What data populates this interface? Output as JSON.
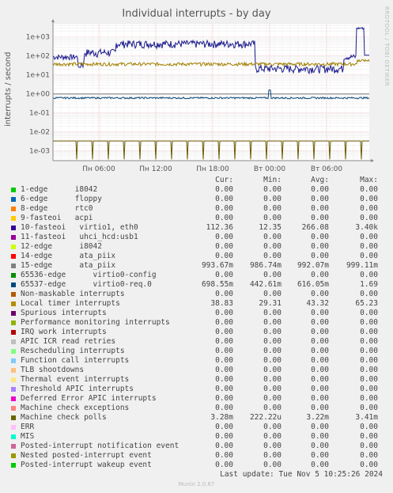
{
  "chart_data": {
    "type": "line",
    "title": "Individual interrupts - by day",
    "ylabel": "interrupts / second",
    "yscale": "log",
    "ylim": [
      0.0003,
      5000
    ],
    "yticks": [
      "1e+03",
      "1e+02",
      "1e+01",
      "1e+00",
      "1e-01",
      "1e-02",
      "1e-03"
    ],
    "xticks": [
      "Пн 06:00",
      "Пн 12:00",
      "Пн 18:00",
      "Вт 00:00",
      "Вт 06:00"
    ],
    "series": [
      {
        "name": "10-fasteoi   virtio1, eth0",
        "color": "#1a1a8c",
        "cur": "112.36",
        "min": "12.35",
        "avg": "266.08",
        "max": "3.40k"
      },
      {
        "name": "Local timer interrupts",
        "color": "#a08000",
        "cur": "38.83",
        "min": "29.31",
        "avg": "43.32",
        "max": "65.23"
      },
      {
        "name": "65537-edge      virtio0-req.0",
        "color": "#0a4a7a",
        "cur": "698.55m",
        "min": "442.61m",
        "avg": "616.05m",
        "max": "1.69"
      },
      {
        "name": "Machine check polls",
        "color": "#6a5a00",
        "cur": "3.28m",
        "min": "222.22u",
        "avg": "3.22m",
        "max": "3.41m"
      }
    ]
  },
  "labels": {
    "side": "RRDTOOL / TOBI OETIKER",
    "cur": "Cur:",
    "min": "Min:",
    "avg": "Avg:",
    "max": "Max:"
  },
  "legend": [
    {
      "name": "1-edge      i8042",
      "color": "#00cc00",
      "cur": "0.00",
      "min": "0.00",
      "avg": "0.00",
      "max": "0.00"
    },
    {
      "name": "6-edge      floppy",
      "color": "#0066b3",
      "cur": "0.00",
      "min": "0.00",
      "avg": "0.00",
      "max": "0.00"
    },
    {
      "name": "8-edge      rtc0",
      "color": "#ff8000",
      "cur": "0.00",
      "min": "0.00",
      "avg": "0.00",
      "max": "0.00"
    },
    {
      "name": "9-fasteoi   acpi",
      "color": "#ffcc00",
      "cur": "0.00",
      "min": "0.00",
      "avg": "0.00",
      "max": "0.00"
    },
    {
      "name": "10-fasteoi   virtio1, eth0",
      "color": "#330099",
      "cur": "112.36",
      "min": "12.35",
      "avg": "266.08",
      "max": "3.40k"
    },
    {
      "name": "11-fasteoi   uhci_hcd:usb1",
      "color": "#990099",
      "cur": "0.00",
      "min": "0.00",
      "avg": "0.00",
      "max": "0.00"
    },
    {
      "name": "12-edge      i8042",
      "color": "#ccff00",
      "cur": "0.00",
      "min": "0.00",
      "avg": "0.00",
      "max": "0.00"
    },
    {
      "name": "14-edge      ata_piix",
      "color": "#ff0000",
      "cur": "0.00",
      "min": "0.00",
      "avg": "0.00",
      "max": "0.00"
    },
    {
      "name": "15-edge      ata_piix",
      "color": "#808080",
      "cur": "993.67m",
      "min": "986.74m",
      "avg": "992.07m",
      "max": "999.11m"
    },
    {
      "name": "65536-edge      virtio0-config",
      "color": "#008f00",
      "cur": "0.00",
      "min": "0.00",
      "avg": "0.00",
      "max": "0.00"
    },
    {
      "name": "65537-edge      virtio0-req.0",
      "color": "#00487d",
      "cur": "698.55m",
      "min": "442.61m",
      "avg": "616.05m",
      "max": "1.69"
    },
    {
      "name": "Non-maskable interrupts",
      "color": "#b35a00",
      "cur": "0.00",
      "min": "0.00",
      "avg": "0.00",
      "max": "0.00"
    },
    {
      "name": "Local timer interrupts",
      "color": "#b38f00",
      "cur": "38.83",
      "min": "29.31",
      "avg": "43.32",
      "max": "65.23"
    },
    {
      "name": "Spurious interrupts",
      "color": "#6b006b",
      "cur": "0.00",
      "min": "0.00",
      "avg": "0.00",
      "max": "0.00"
    },
    {
      "name": "Performance monitoring interrupts",
      "color": "#8fb300",
      "cur": "0.00",
      "min": "0.00",
      "avg": "0.00",
      "max": "0.00"
    },
    {
      "name": "IRQ work interrupts",
      "color": "#b30000",
      "cur": "0.00",
      "min": "0.00",
      "avg": "0.00",
      "max": "0.00"
    },
    {
      "name": "APIC ICR read retries",
      "color": "#bebebe",
      "cur": "0.00",
      "min": "0.00",
      "avg": "0.00",
      "max": "0.00"
    },
    {
      "name": "Rescheduling interrupts",
      "color": "#80ff80",
      "cur": "0.00",
      "min": "0.00",
      "avg": "0.00",
      "max": "0.00"
    },
    {
      "name": "Function call interrupts",
      "color": "#80c9ff",
      "cur": "0.00",
      "min": "0.00",
      "avg": "0.00",
      "max": "0.00"
    },
    {
      "name": "TLB shootdowns",
      "color": "#ffc080",
      "cur": "0.00",
      "min": "0.00",
      "avg": "0.00",
      "max": "0.00"
    },
    {
      "name": "Thermal event interrupts",
      "color": "#ffe680",
      "cur": "0.00",
      "min": "0.00",
      "avg": "0.00",
      "max": "0.00"
    },
    {
      "name": "Threshold APIC interrupts",
      "color": "#aa80ff",
      "cur": "0.00",
      "min": "0.00",
      "avg": "0.00",
      "max": "0.00"
    },
    {
      "name": "Deferred Error APIC interrupts",
      "color": "#ee00cc",
      "cur": "0.00",
      "min": "0.00",
      "avg": "0.00",
      "max": "0.00"
    },
    {
      "name": "Machine check exceptions",
      "color": "#ff8080",
      "cur": "0.00",
      "min": "0.00",
      "avg": "0.00",
      "max": "0.00"
    },
    {
      "name": "Machine check polls",
      "color": "#666600",
      "cur": "3.28m",
      "min": "222.22u",
      "avg": "3.22m",
      "max": "3.41m"
    },
    {
      "name": "ERR",
      "color": "#ffbfff",
      "cur": "0.00",
      "min": "0.00",
      "avg": "0.00",
      "max": "0.00"
    },
    {
      "name": "MIS",
      "color": "#00ffcc",
      "cur": "0.00",
      "min": "0.00",
      "avg": "0.00",
      "max": "0.00"
    },
    {
      "name": "Posted-interrupt notification event",
      "color": "#cc6699",
      "cur": "0.00",
      "min": "0.00",
      "avg": "0.00",
      "max": "0.00"
    },
    {
      "name": "Nested posted-interrupt event",
      "color": "#999900",
      "cur": "0.00",
      "min": "0.00",
      "avg": "0.00",
      "max": "0.00"
    },
    {
      "name": "Posted-interrupt wakeup event",
      "color": "#00cc00",
      "cur": "0.00",
      "min": "0.00",
      "avg": "0.00",
      "max": "0.00"
    }
  ],
  "footer": {
    "last_update": "Last update:  Tue Nov  5 10:25:26 2024",
    "munin": "Munin 2.0.67"
  }
}
